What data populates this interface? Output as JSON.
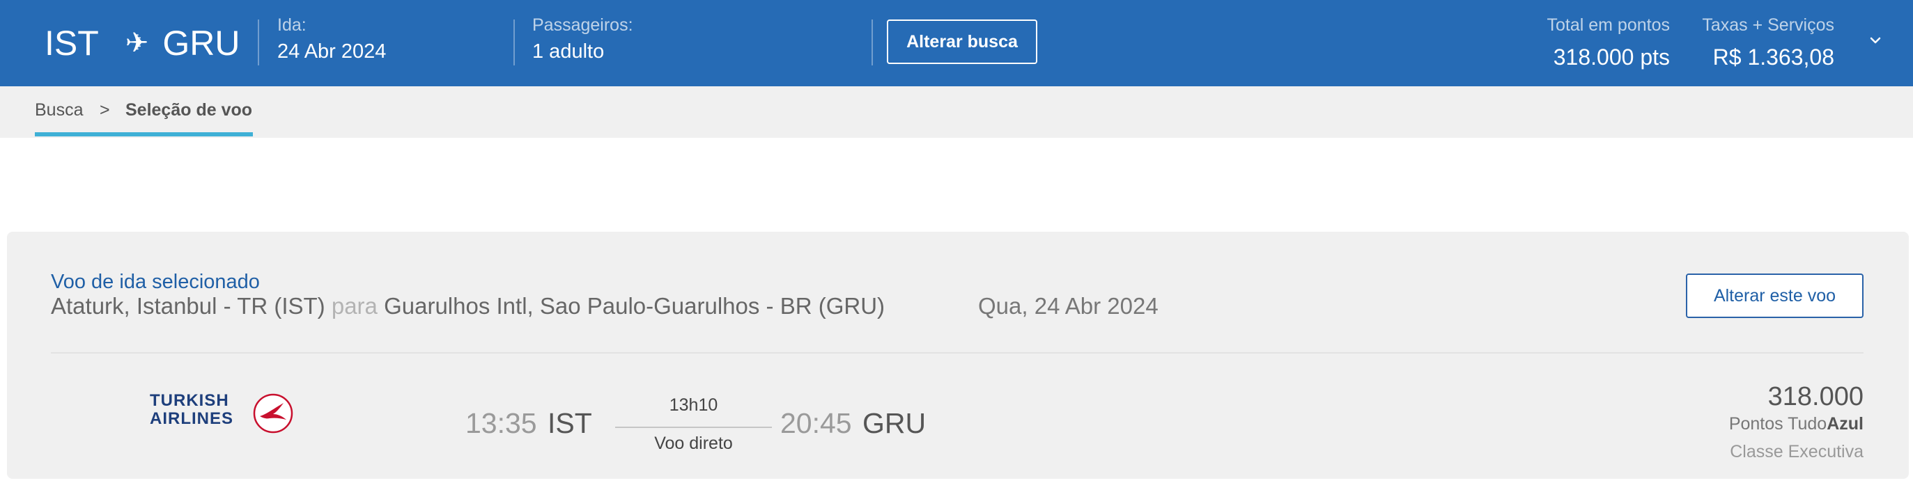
{
  "header": {
    "origin": "IST",
    "destination": "GRU",
    "plane_icon": "plane-icon",
    "ida_label": "Ida:",
    "ida_value": "24 Abr 2024",
    "passengers_label": "Passageiros:",
    "passengers_value": "1 adulto",
    "change_search_button": "Alterar busca",
    "total_points_label": "Total em pontos",
    "total_points_value": "318.000 pts",
    "taxes_label": "Taxas + Serviços",
    "taxes_value": "R$ 1.363,08",
    "expand_icon": "chevron-down-icon",
    "background_color": "#266bb5"
  },
  "breadcrumb": {
    "items": [
      "Busca",
      "Seleção de voo"
    ],
    "separator": ">",
    "active_underline_color": "#3fb0d6"
  },
  "selected_flight": {
    "title": "Voo de ida selecionado",
    "from": "Ataturk, Istanbul - TR (IST)",
    "connector": "para",
    "to": "Guarulhos Intl, Sao Paulo-Guarulhos - BR (GRU)",
    "date": "Qua, 24 Abr 2024",
    "change_flight_button": "Alterar este voo",
    "airline": {
      "name_line1": "TURKISH",
      "name_line2": "AIRLINES",
      "logo_icon": "turkish-airlines-crane-icon"
    },
    "departure_time": "13:35",
    "departure_code": "IST",
    "duration": "13h10",
    "stops": "Voo direto",
    "arrival_time": "20:45",
    "arrival_code": "GRU",
    "price_points": "318.000",
    "points_label_prefix": "Pontos Tudo",
    "points_label_brand": "Azul",
    "cabin_class": "Classe Executiva"
  }
}
